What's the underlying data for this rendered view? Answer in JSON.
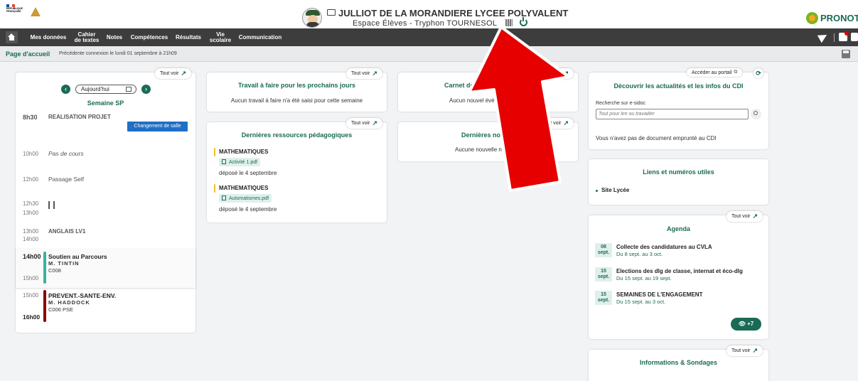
{
  "header": {
    "school_name": "JULLIOT DE LA MORANDIERE LYCEE POLYVALENT",
    "space_label": "Espace Élèves - Tryphon TOURNESOL",
    "brand": "PRONOT",
    "republic_line1": "RÉPUBLIQUE",
    "republic_line2": "FRANÇAISE"
  },
  "nav": {
    "items": [
      {
        "line1": "Mes données",
        "line2": ""
      },
      {
        "line1": "Cahier",
        "line2": "de textes"
      },
      {
        "line1": "Notes",
        "line2": ""
      },
      {
        "line1": "Compétences",
        "line2": ""
      },
      {
        "line1": "Résultats",
        "line2": ""
      },
      {
        "line1": "Vie",
        "line2": "scolaire"
      },
      {
        "line1": "Communication",
        "line2": ""
      }
    ]
  },
  "subbar": {
    "page": "Page d'accueil",
    "last_connection": "Précédente connexion le lundi 01 septembre à 21h09"
  },
  "common": {
    "see_all": "Tout voir"
  },
  "schedule": {
    "today": "Aujourd'hui",
    "week": "Semaine SP",
    "room_change": "Changement de salle",
    "slots": [
      {
        "time": "8h30",
        "end": "",
        "subject": "REALISATION PROJET",
        "teacher": "",
        "room": ""
      },
      {
        "time": "10h00",
        "end": "",
        "subject": "Pas de cours",
        "teacher": "",
        "room": ""
      },
      {
        "time": "12h00",
        "end": "",
        "subject": "Passage Self",
        "teacher": "",
        "room": ""
      },
      {
        "time": "12h30",
        "end": "13h00",
        "subject": "",
        "teacher": "",
        "room": ""
      },
      {
        "time": "13h00",
        "end": "14h00",
        "subject": "ANGLAIS LV1",
        "teacher": "",
        "room": ""
      },
      {
        "time": "14h00",
        "end": "15h00",
        "subject": "Soutien au Parcours",
        "teacher": "M. TINTIN",
        "room": "C008"
      },
      {
        "time": "15h00",
        "end": "16h00",
        "subject": "PREVENT.-SANTE-ENV.",
        "teacher": "M. HADDOCK",
        "room": "C006 PSE"
      }
    ]
  },
  "homework": {
    "title": "Travail à faire pour les prochains jours",
    "empty": "Aucun travail à faire n'a été saisi pour cette semaine"
  },
  "resources": {
    "title": "Dernières ressources pédagogiques",
    "items": [
      {
        "subject": "MATHEMATIQUES",
        "file": "Activité 1.pdf",
        "date": "déposé le 4 septembre"
      },
      {
        "subject": "MATHEMATIQUES",
        "file": "Automatismes.pdf",
        "date": "déposé le 4 septembre"
      }
    ]
  },
  "carnet": {
    "title": "Carnet de correspon",
    "empty": "Aucun nouvel évène"
  },
  "grades": {
    "title": "Dernières note",
    "empty": "Aucune nouvelle n"
  },
  "cdi": {
    "portal": "Accéder au portail",
    "title": "Découvrir les actualités et les infos du CDI",
    "search_label": "Recherche sur e-sidoc",
    "search_placeholder": "Tout pour lire ou travailler",
    "empty": "Vous n'avez pas de document emprunté au CDI"
  },
  "links": {
    "title": "Liens et numéros utiles",
    "items": [
      "Site Lycée"
    ]
  },
  "agenda": {
    "title": "Agenda",
    "more": "+7",
    "events": [
      {
        "day": "08",
        "month": "sept.",
        "title": "Collecte des candidatures au CVLA",
        "range": "Du 8 sept. au 3 oct."
      },
      {
        "day": "15",
        "month": "sept.",
        "title": "Elections des dlg de classe, internat et éco-dlg",
        "range": "Du 15 sept. au 19 sept."
      },
      {
        "day": "15",
        "month": "sept.",
        "title": "SEMAINES DE L'ENGAGEMENT",
        "range": "Du 15 sept. au 3 oct."
      }
    ]
  },
  "info": {
    "title": "Informations & Sondages"
  },
  "colors": {
    "accent": "#1a6b55",
    "nav_bg": "#3d3d3d",
    "arrow": "#e60000",
    "room_change": "#1f6fc5",
    "bar_teal": "#3bb0a0",
    "bar_red": "#8b0000",
    "bar_yellow": "#f0c020"
  }
}
